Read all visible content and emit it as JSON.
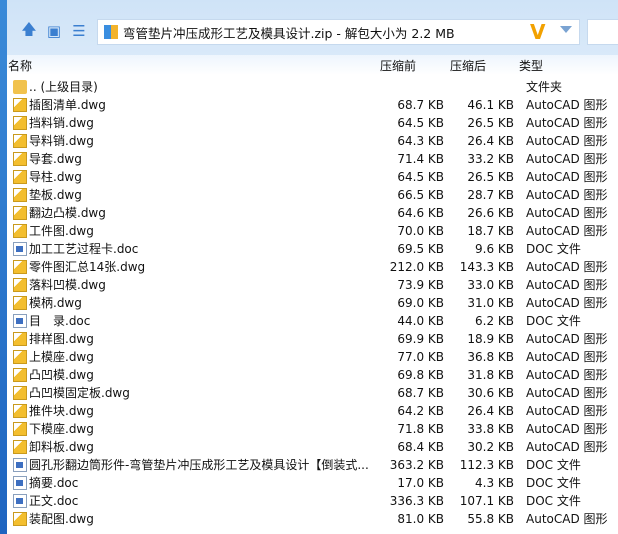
{
  "address": {
    "title": "弯管垫片冲压成形工艺及模具设计.zip - 解包大小为 2.2 MB"
  },
  "columns": {
    "name": "名称",
    "before": "压缩前",
    "after": "压缩后",
    "type": "类型"
  },
  "parent": {
    "name": ".. (上级目录)",
    "type": "文件夹"
  },
  "files": [
    {
      "name": "插图清单.dwg",
      "before": "68.7 KB",
      "after": "46.1 KB",
      "type": "AutoCAD 图形",
      "icon": "dwg"
    },
    {
      "name": "挡料销.dwg",
      "before": "64.5 KB",
      "after": "26.5 KB",
      "type": "AutoCAD 图形",
      "icon": "dwg"
    },
    {
      "name": "导料销.dwg",
      "before": "64.3 KB",
      "after": "26.4 KB",
      "type": "AutoCAD 图形",
      "icon": "dwg"
    },
    {
      "name": "导套.dwg",
      "before": "71.4 KB",
      "after": "33.2 KB",
      "type": "AutoCAD 图形",
      "icon": "dwg"
    },
    {
      "name": "导柱.dwg",
      "before": "64.5 KB",
      "after": "26.5 KB",
      "type": "AutoCAD 图形",
      "icon": "dwg"
    },
    {
      "name": "垫板.dwg",
      "before": "66.5 KB",
      "after": "28.7 KB",
      "type": "AutoCAD 图形",
      "icon": "dwg"
    },
    {
      "name": "翻边凸模.dwg",
      "before": "64.6 KB",
      "after": "26.6 KB",
      "type": "AutoCAD 图形",
      "icon": "dwg"
    },
    {
      "name": "工件图.dwg",
      "before": "70.0 KB",
      "after": "18.7 KB",
      "type": "AutoCAD 图形",
      "icon": "dwg"
    },
    {
      "name": "加工工艺过程卡.doc",
      "before": "69.5 KB",
      "after": "9.6 KB",
      "type": "DOC 文件",
      "icon": "doc"
    },
    {
      "name": "零件图汇总14张.dwg",
      "before": "212.0 KB",
      "after": "143.3 KB",
      "type": "AutoCAD 图形",
      "icon": "dwg"
    },
    {
      "name": "落料凹模.dwg",
      "before": "73.9 KB",
      "after": "33.0 KB",
      "type": "AutoCAD 图形",
      "icon": "dwg"
    },
    {
      "name": "模柄.dwg",
      "before": "69.0 KB",
      "after": "31.0 KB",
      "type": "AutoCAD 图形",
      "icon": "dwg"
    },
    {
      "name": "目　录.doc",
      "before": "44.0 KB",
      "after": "6.2 KB",
      "type": "DOC 文件",
      "icon": "doc"
    },
    {
      "name": "排样图.dwg",
      "before": "69.9 KB",
      "after": "18.9 KB",
      "type": "AutoCAD 图形",
      "icon": "dwg"
    },
    {
      "name": "上模座.dwg",
      "before": "77.0 KB",
      "after": "36.8 KB",
      "type": "AutoCAD 图形",
      "icon": "dwg"
    },
    {
      "name": "凸凹模.dwg",
      "before": "69.8 KB",
      "after": "31.8 KB",
      "type": "AutoCAD 图形",
      "icon": "dwg"
    },
    {
      "name": "凸凹模固定板.dwg",
      "before": "68.7 KB",
      "after": "30.6 KB",
      "type": "AutoCAD 图形",
      "icon": "dwg"
    },
    {
      "name": "推件块.dwg",
      "before": "64.2 KB",
      "after": "26.4 KB",
      "type": "AutoCAD 图形",
      "icon": "dwg"
    },
    {
      "name": "下模座.dwg",
      "before": "71.8 KB",
      "after": "33.8 KB",
      "type": "AutoCAD 图形",
      "icon": "dwg"
    },
    {
      "name": "卸料板.dwg",
      "before": "68.4 KB",
      "after": "30.2 KB",
      "type": "AutoCAD 图形",
      "icon": "dwg"
    },
    {
      "name": "圆孔形翻边筒形件-弯管垫片冲压成形工艺及模具设计【倒装式...",
      "before": "363.2 KB",
      "after": "112.3 KB",
      "type": "DOC 文件",
      "icon": "doc"
    },
    {
      "name": "摘要.doc",
      "before": "17.0 KB",
      "after": "4.3 KB",
      "type": "DOC 文件",
      "icon": "doc"
    },
    {
      "name": "正文.doc",
      "before": "336.3 KB",
      "after": "107.1 KB",
      "type": "DOC 文件",
      "icon": "doc"
    },
    {
      "name": "装配图.dwg",
      "before": "81.0 KB",
      "after": "55.8 KB",
      "type": "AutoCAD 图形",
      "icon": "dwg"
    }
  ]
}
